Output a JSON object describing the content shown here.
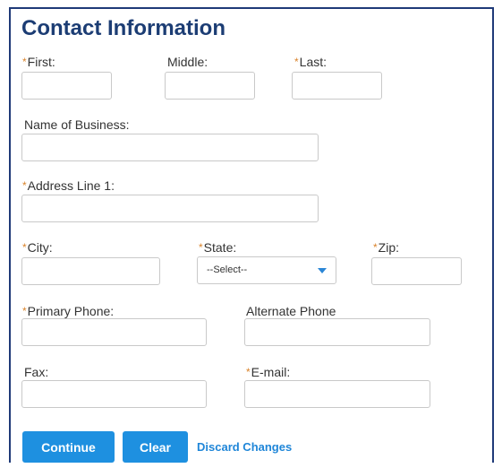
{
  "section": {
    "title": "Contact Information"
  },
  "required_marker": "*",
  "fields": {
    "first": {
      "label": "First:",
      "value": ""
    },
    "middle": {
      "label": "Middle:",
      "value": ""
    },
    "last": {
      "label": "Last:",
      "value": ""
    },
    "business": {
      "label": "Name of Business:",
      "value": ""
    },
    "address1": {
      "label": "Address Line 1:",
      "value": ""
    },
    "city": {
      "label": "City:",
      "value": ""
    },
    "state": {
      "label": "State:",
      "selected": "--Select--"
    },
    "zip": {
      "label": "Zip:",
      "value": ""
    },
    "primary_phone": {
      "label": "Primary Phone:",
      "value": ""
    },
    "alternate_phone": {
      "label": "Alternate Phone",
      "value": ""
    },
    "fax": {
      "label": "Fax:",
      "value": ""
    },
    "email": {
      "label": "E-mail:",
      "value": ""
    }
  },
  "actions": {
    "continue_label": "Continue",
    "clear_label": "Clear",
    "discard_label": "Discard Changes"
  },
  "colors": {
    "title": "#1c3d74",
    "required_marker": "#d9832b",
    "button": "#1e90e0",
    "link": "#1f86d8"
  }
}
